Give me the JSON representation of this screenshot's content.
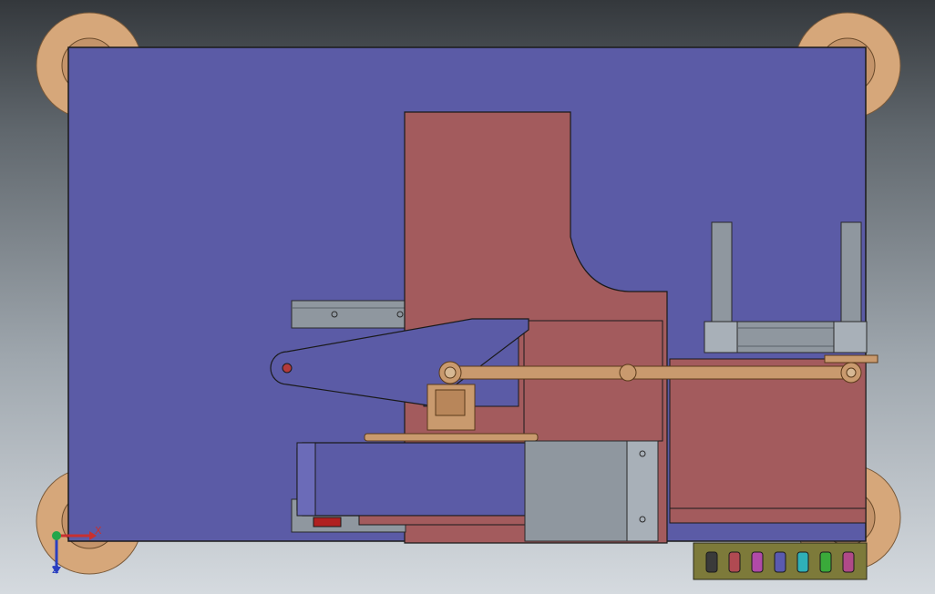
{
  "viewport": {
    "background_top": "#34383c",
    "background_bottom": "#d5dadf",
    "orientation": "top view"
  },
  "colors": {
    "base_plate": "#5b5ba6",
    "column_part": "#a35b5d",
    "bronze_part": "#c99a6e",
    "aluminum_profile": "#8f979f",
    "wheel": "#d6a77a",
    "outline": "#1a1a1a"
  },
  "triad": {
    "x_label": "X",
    "z_label": "Z",
    "x_color": "#c83030",
    "z_color": "#2a3fc0",
    "y_color": "#22a64a"
  },
  "connector_strip": {
    "pin_colors": [
      "#3a3a3a",
      "#b04a52",
      "#b04aa8",
      "#5a5aaf",
      "#2fb0b8",
      "#3aaa3a",
      "#b04a88"
    ]
  }
}
